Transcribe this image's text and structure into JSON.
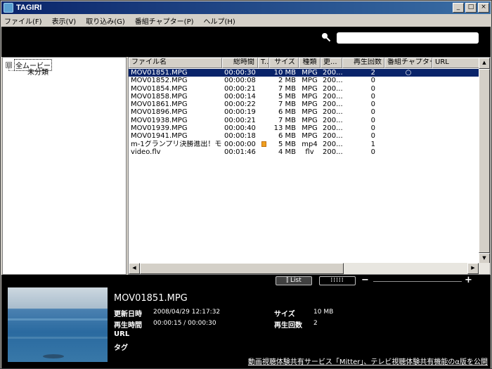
{
  "window": {
    "title": "TAGIRI",
    "minimize": "_",
    "maximize": "□",
    "close": "×"
  },
  "menu": [
    "ファイル(F)",
    "表示(V)",
    "取り込み(G)",
    "番組チャプター(P)",
    "ヘルプ(H)"
  ],
  "tree": {
    "toggle": "⊟",
    "root": "全ムービー",
    "child": "未分類"
  },
  "columns": [
    "ファイル名",
    "総時間",
    "T..",
    "サイズ",
    "種類",
    "更...",
    "再生回数",
    "番組チャプター",
    "URL"
  ],
  "rows": [
    {
      "name": "MOV01851.MPG",
      "duration": "00:00:30",
      "t": "",
      "size": "10 MB",
      "type": "MPG",
      "date": "200...",
      "plays": "2",
      "chapter": "○",
      "url": ""
    },
    {
      "name": "MOV01852.MPG",
      "duration": "00:00:08",
      "t": "",
      "size": "2 MB",
      "type": "MPG",
      "date": "200...",
      "plays": "0",
      "chapter": "",
      "url": ""
    },
    {
      "name": "MOV01854.MPG",
      "duration": "00:00:21",
      "t": "",
      "size": "7 MB",
      "type": "MPG",
      "date": "200...",
      "plays": "0",
      "chapter": "",
      "url": ""
    },
    {
      "name": "MOV01858.MPG",
      "duration": "00:00:14",
      "t": "",
      "size": "5 MB",
      "type": "MPG",
      "date": "200...",
      "plays": "0",
      "chapter": "",
      "url": ""
    },
    {
      "name": "MOV01861.MPG",
      "duration": "00:00:22",
      "t": "",
      "size": "7 MB",
      "type": "MPG",
      "date": "200...",
      "plays": "0",
      "chapter": "",
      "url": ""
    },
    {
      "name": "MOV01896.MPG",
      "duration": "00:00:19",
      "t": "",
      "size": "6 MB",
      "type": "MPG",
      "date": "200...",
      "plays": "0",
      "chapter": "",
      "url": ""
    },
    {
      "name": "MOV01938.MPG",
      "duration": "00:00:21",
      "t": "",
      "size": "7 MB",
      "type": "MPG",
      "date": "200...",
      "plays": "0",
      "chapter": "",
      "url": ""
    },
    {
      "name": "MOV01939.MPG",
      "duration": "00:00:40",
      "t": "",
      "size": "13 MB",
      "type": "MPG",
      "date": "200...",
      "plays": "0",
      "chapter": "",
      "url": ""
    },
    {
      "name": "MOV01941.MPG",
      "duration": "00:00:18",
      "t": "",
      "size": "6 MB",
      "type": "MPG",
      "date": "200...",
      "plays": "0",
      "chapter": "",
      "url": ""
    },
    {
      "name": "m-1グランプリ決勝進出！モ...",
      "duration": "00:00:00",
      "t": "icon",
      "size": "5 MB",
      "type": "mp4",
      "date": "200...",
      "plays": "1",
      "chapter": "",
      "url": ""
    },
    {
      "name": "video.flv",
      "duration": "00:01:46",
      "t": "",
      "size": "4 MB",
      "type": "flv",
      "date": "200...",
      "plays": "0",
      "chapter": "",
      "url": ""
    }
  ],
  "view": {
    "list_label": "⫿ List",
    "grid_label": "⁞⁞⁞⁞⁞",
    "zoom_minus": "−",
    "zoom_plus": "+"
  },
  "details": {
    "title": "MOV01851.MPG",
    "updated_label": "更新日時",
    "updated_value": "2008/04/29 12:17:32",
    "playtime_label": "再生時間",
    "playtime_value": "00:00:15 / 00:00:30",
    "url_label": "URL",
    "tag_label": "タグ",
    "size_label": "サイズ",
    "size_value": "10 MB",
    "plays_label": "再生回数",
    "plays_value": "2"
  },
  "footer": {
    "link": "動画視聴体験共有サービス「Mitter」、テレビ視聴体験共有機能のα版を公開"
  },
  "colors": {
    "titlebar": "#0a246a",
    "selected_row": "#0a246a",
    "panel_bg": "#000000"
  }
}
